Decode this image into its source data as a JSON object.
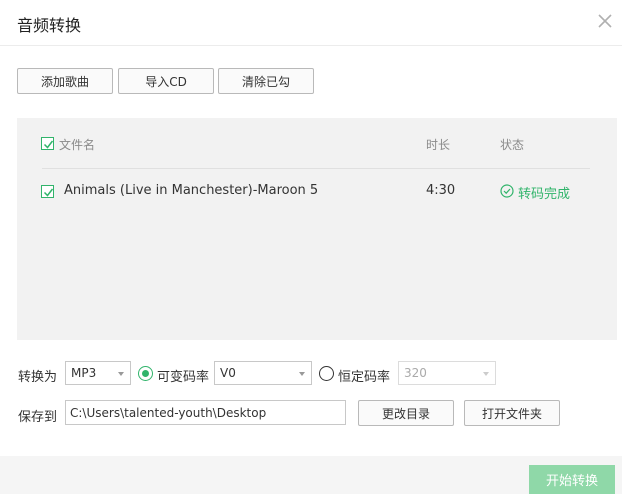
{
  "window": {
    "title": "音频转换"
  },
  "toolbar": {
    "add_label": "添加歌曲",
    "import_label": "导入CD",
    "clear_label": "清除已勾"
  },
  "table": {
    "headers": {
      "name": "文件名",
      "duration": "时长",
      "status": "状态"
    },
    "rows": [
      {
        "checked": true,
        "name": "Animals (Live in Manchester)-Maroon 5",
        "duration": "4:30",
        "status": "转码完成"
      }
    ]
  },
  "convert": {
    "label": "转换为",
    "format": "MP3",
    "vbr_label": "可变码率",
    "vbr_selected": true,
    "vbr_value": "V0",
    "cbr_label": "恒定码率",
    "cbr_value": "320"
  },
  "save": {
    "label": "保存到",
    "path": "C:\\Users\\talented-youth\\Desktop",
    "change_dir_label": "更改目录",
    "open_folder_label": "打开文件夹"
  },
  "footer": {
    "start_label": "开始转换"
  },
  "colors": {
    "accent": "#31b46b",
    "start_button": "#8fd8a8",
    "panel": "#f2f2f2"
  }
}
